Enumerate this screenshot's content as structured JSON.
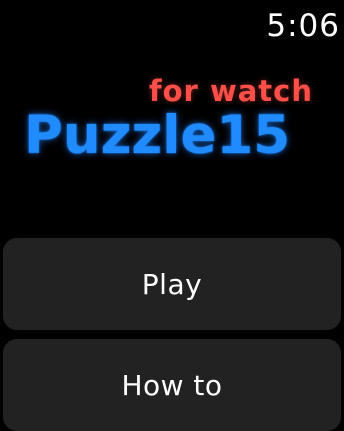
{
  "status": {
    "time": "5:06"
  },
  "header": {
    "subtitle": "for watch",
    "title": "Puzzle15"
  },
  "menu": {
    "play_label": "Play",
    "howto_label": "How to"
  },
  "colors": {
    "background": "#000000",
    "subtitle": "#ff4f48",
    "title": "#1f8bff",
    "button_background": "#222222",
    "button_text": "#ffffff"
  }
}
